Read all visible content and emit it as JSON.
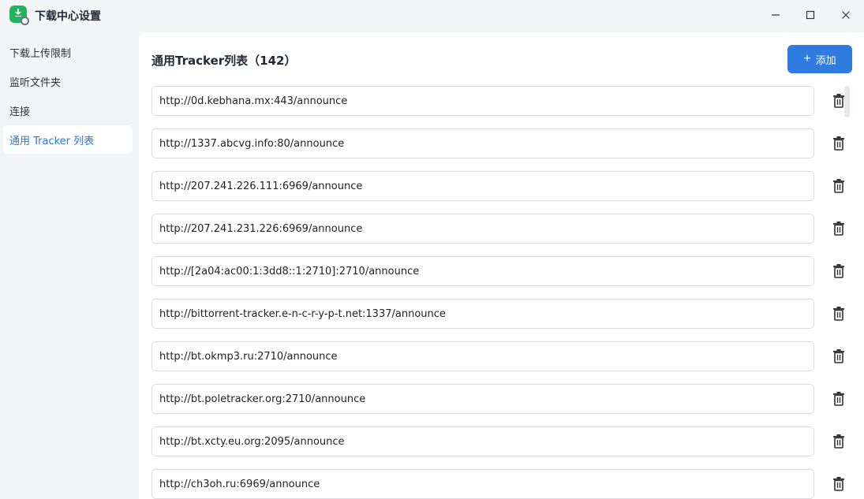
{
  "window": {
    "title": "下载中心设置"
  },
  "sidebar": {
    "items": [
      {
        "label": "下载上传限制",
        "active": false
      },
      {
        "label": "监听文件夹",
        "active": false
      },
      {
        "label": "连接",
        "active": false
      },
      {
        "label": "通用 Tracker 列表",
        "active": true
      }
    ]
  },
  "main": {
    "title": "通用Tracker列表（142）",
    "add_label": "添加",
    "add_icon": "plus-icon",
    "delete_icon": "trash-icon",
    "trackers": [
      "http://0d.kebhana.mx:443/announce",
      "http://1337.abcvg.info:80/announce",
      "http://207.241.226.111:6969/announce",
      "http://207.241.231.226:6969/announce",
      "http://[2a04:ac00:1:3dd8::1:2710]:2710/announce",
      "http://bittorrent-tracker.e-n-c-r-y-p-t.net:1337/announce",
      "http://bt.okmp3.ru:2710/announce",
      "http://bt.poletracker.org:2710/announce",
      "http://bt.xcty.eu.org:2095/announce",
      "http://ch3oh.ru:6969/announce"
    ]
  },
  "colors": {
    "accent": "#2f7be0",
    "sidebar_active_text": "#2b78dc",
    "app_icon": "#22b35e"
  }
}
